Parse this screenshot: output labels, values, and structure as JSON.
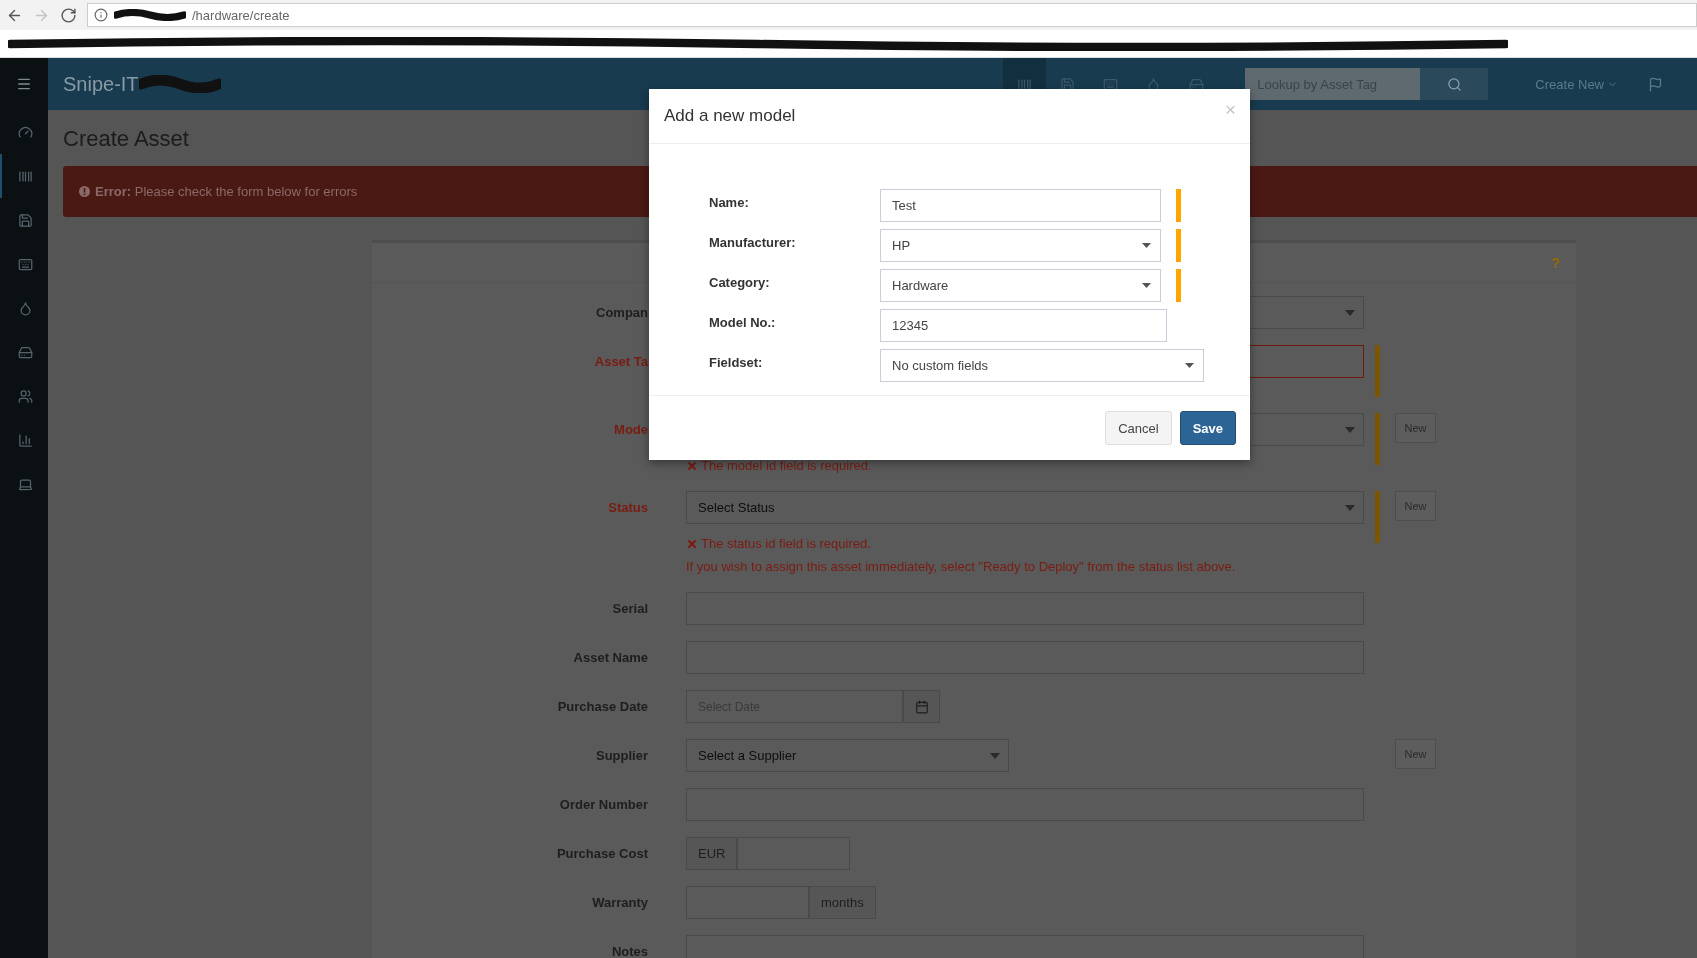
{
  "browser": {
    "nav": [
      {
        "kind": "back",
        "disabled": false
      },
      {
        "kind": "forward",
        "disabled": true
      },
      {
        "kind": "reload",
        "disabled": false
      }
    ],
    "url": "/hardware/create"
  },
  "header": {
    "brand": "Snipe-IT",
    "icons": [
      {
        "kind": "barcode",
        "selected": true
      },
      {
        "kind": "save",
        "selected": false
      },
      {
        "kind": "keyboard",
        "selected": false
      },
      {
        "kind": "droplet",
        "selected": false
      },
      {
        "kind": "drive",
        "selected": false
      }
    ],
    "search": {
      "placeholder": "Lookup by Asset Tag"
    },
    "create": "Create New"
  },
  "sidebar": {
    "items": [
      {
        "kind": "dashboard",
        "selected": false
      },
      {
        "kind": "barcode",
        "selected": true
      },
      {
        "kind": "save",
        "selected": false
      },
      {
        "kind": "keyboard",
        "selected": false
      },
      {
        "kind": "droplet",
        "selected": false
      },
      {
        "kind": "drive",
        "selected": false
      },
      {
        "kind": "users",
        "selected": false
      },
      {
        "kind": "chart",
        "selected": false
      },
      {
        "kind": "laptop",
        "selected": false
      }
    ]
  },
  "page": {
    "title": "Create Asset",
    "alert": "**Error:** Please check the form below for errors",
    "help": "?"
  },
  "form": [
    {
      "label": "Compan",
      "kind": "select",
      "error": false,
      "required": false
    },
    {
      "label": "Asset Ta",
      "kind": "text",
      "error": true,
      "required": true
    },
    {
      "label": "Mode",
      "kind": "select",
      "error": true,
      "required": true,
      "button": "New",
      "messages": [
        {
          "kind": "error",
          "text": "The model id field is required."
        }
      ]
    },
    {
      "label": "Status",
      "kind": "select",
      "error": true,
      "required": true,
      "value": "Select Status",
      "button": "New",
      "messages": [
        {
          "kind": "error",
          "text": "The status id field is required."
        },
        {
          "kind": "hint",
          "text": "If you wish to assign this asset immediately, select \"Ready to Deploy\" from the status list above."
        }
      ]
    },
    {
      "label": "Serial",
      "kind": "text",
      "error": false,
      "required": false
    },
    {
      "label": "Asset Name",
      "kind": "text",
      "error": false,
      "required": false
    },
    {
      "label": "Purchase Date",
      "kind": "date",
      "error": false,
      "required": false,
      "placeholder": "Select Date"
    },
    {
      "label": "Supplier",
      "kind": "select-short",
      "error": false,
      "required": false,
      "value": "Select a Supplier",
      "button": "New"
    },
    {
      "label": "Order Number",
      "kind": "text",
      "error": false,
      "required": false
    },
    {
      "label": "Purchase Cost",
      "kind": "currency",
      "error": false,
      "required": false,
      "addon": "EUR"
    },
    {
      "label": "Warranty",
      "kind": "duration",
      "error": false,
      "required": false,
      "addon": "months"
    },
    {
      "label": "Notes",
      "kind": "textarea",
      "error": false,
      "required": false
    }
  ],
  "modal": {
    "title": "Add a new model",
    "close": "×",
    "fields": [
      {
        "label": "Name:",
        "kind": "text",
        "value": "Test",
        "required": true
      },
      {
        "label": "Manufacturer:",
        "kind": "select",
        "value": "HP",
        "required": true
      },
      {
        "label": "Category:",
        "kind": "select",
        "value": "Hardware",
        "required": true
      },
      {
        "label": "Model No.:",
        "kind": "text",
        "value": "12345",
        "required": false
      },
      {
        "label": "Fieldset:",
        "kind": "select",
        "value": "No custom fields",
        "required": false
      }
    ],
    "buttons": [
      {
        "label": "Cancel",
        "kind": "default"
      },
      {
        "label": "Save",
        "kind": "primary"
      }
    ]
  }
}
